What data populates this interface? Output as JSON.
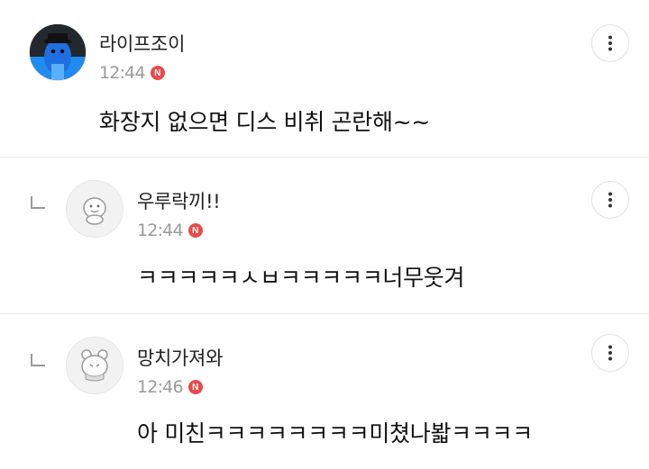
{
  "comments": [
    {
      "author": "라이프조이",
      "time": "12:44",
      "badge": "N",
      "text": "화장지 없으면 디스 비취 곤란해~~",
      "is_reply": false,
      "avatar": "blue-character-avatar"
    },
    {
      "author": "우루락끼!!",
      "time": "12:44",
      "badge": "N",
      "text": "ㅋㅋㅋㅋㅋㅅㅂㅋㅋㅋㅋㅋ너무웃겨",
      "is_reply": true,
      "avatar": "default-character-avatar"
    },
    {
      "author": "망치가져와",
      "time": "12:46",
      "badge": "N",
      "text": "아 미친ㅋㅋㅋㅋㅋㅋㅋㅋ미쳤나봛ㅋㅋㅋㅋ",
      "is_reply": true,
      "avatar": "default-character-avatar"
    }
  ],
  "icons": {
    "more": "vertical-dots-icon",
    "reply": "reply-arrow-icon",
    "new_badge": "new-badge-icon"
  },
  "colors": {
    "badge": "#e84a4a",
    "timestamp": "#9a9a9a",
    "divider": "#e9e9e9"
  }
}
